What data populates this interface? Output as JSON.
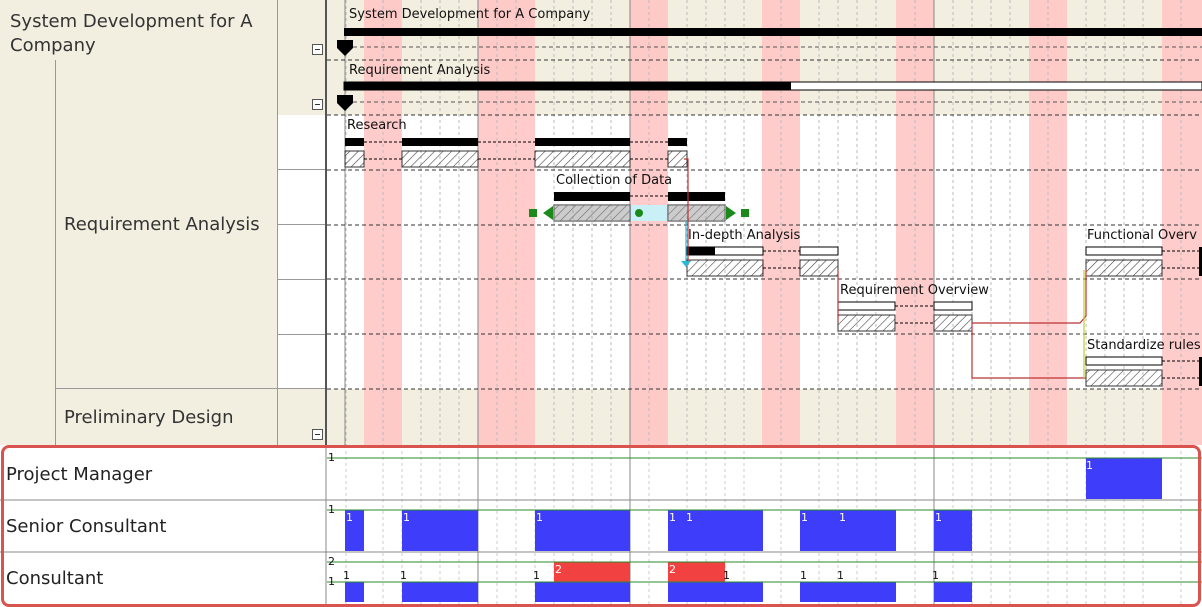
{
  "tree": {
    "project": "System Development for A Company",
    "phase1": "Requirement Analysis",
    "phase2": "Preliminary Design"
  },
  "gantt": {
    "project_bar_label": "System Development for A Company",
    "phase_bar_label": "Requirement Analysis",
    "tasks": [
      {
        "name": "Research"
      },
      {
        "name": "Collection of Data"
      },
      {
        "name": "In-depth Analysis"
      },
      {
        "name": "Requirement Overview"
      },
      {
        "name": "Functional Overv"
      },
      {
        "name": "Standardize rules"
      }
    ]
  },
  "resources": {
    "rows": [
      {
        "name": "Project Manager",
        "max": "1"
      },
      {
        "name": "Senior Consultant",
        "max": "1"
      },
      {
        "name": "Consultant",
        "max": "2",
        "line": "1"
      }
    ],
    "load_label_one": "1",
    "load_label_two": "2"
  },
  "colors": {
    "nonworking": "#ffc6c6",
    "summary_bg": "#f2efe1",
    "resource_load": "#3d3dfa",
    "overload": "#f24141",
    "highlight_border": "#d9534f"
  }
}
